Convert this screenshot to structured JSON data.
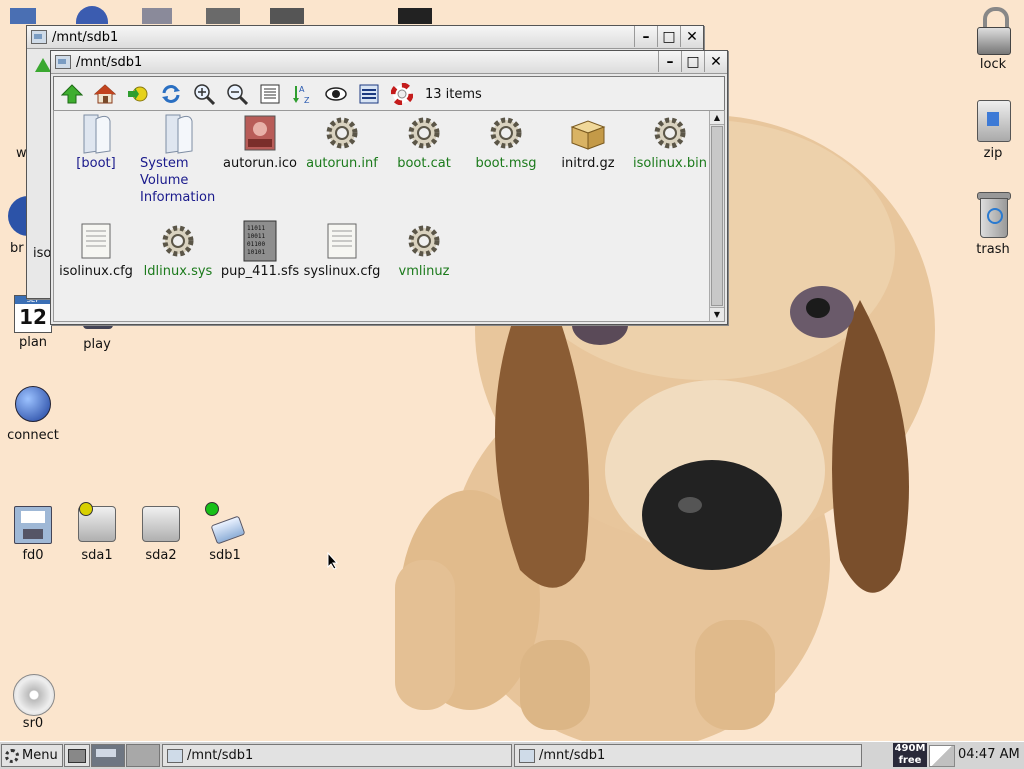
{
  "desktop": {
    "left_icons": [
      {
        "label": "plan",
        "date": "12",
        "month": "SEP"
      },
      {
        "label": "play"
      },
      {
        "label": "connect"
      },
      {
        "label": "fd0"
      },
      {
        "label": "sda1"
      },
      {
        "label": "sda2"
      },
      {
        "label": "sdb1"
      },
      {
        "label": "sr0"
      }
    ],
    "partial_labels": {
      "w": "w",
      "br": "br",
      "iso": "iso"
    },
    "right_icons": [
      {
        "label": "lock"
      },
      {
        "label": "zip"
      },
      {
        "label": "trash"
      }
    ]
  },
  "back_window": {
    "title": "/mnt/sdb1"
  },
  "front_window": {
    "title": "/mnt/sdb1",
    "item_count": "13 items",
    "toolbar_icons": [
      "up-arrow-icon",
      "home-icon",
      "goto-icon",
      "refresh-icon",
      "zoom-in-icon",
      "zoom-out-icon",
      "details-view-icon",
      "sort-az-icon",
      "eye-icon",
      "list-view-icon",
      "help-lifebuoy-icon"
    ],
    "files": [
      {
        "name": "[boot]",
        "kind": "dir",
        "icon": "folder-icon"
      },
      {
        "name": "System Volume Information",
        "kind": "dir",
        "icon": "folder-icon"
      },
      {
        "name": "autorun.ico",
        "kind": "reg",
        "icon": "image-icon"
      },
      {
        "name": "autorun.inf",
        "kind": "exe",
        "icon": "gear-icon"
      },
      {
        "name": "boot.cat",
        "kind": "exe",
        "icon": "gear-icon"
      },
      {
        "name": "boot.msg",
        "kind": "exe",
        "icon": "gear-icon"
      },
      {
        "name": "initrd.gz",
        "kind": "reg",
        "icon": "package-icon"
      },
      {
        "name": "isolinux.bin",
        "kind": "exe",
        "icon": "gear-icon"
      },
      {
        "name": "isolinux.cfg",
        "kind": "reg",
        "icon": "text-file-icon"
      },
      {
        "name": "ldlinux.sys",
        "kind": "exe",
        "icon": "gear-icon"
      },
      {
        "name": "pup_411.sfs",
        "kind": "reg",
        "icon": "binary-file-icon"
      },
      {
        "name": "syslinux.cfg",
        "kind": "reg",
        "icon": "text-file-icon"
      },
      {
        "name": "vmlinuz",
        "kind": "exe",
        "icon": "gear-icon"
      }
    ]
  },
  "taskbar": {
    "menu_label": "Menu",
    "task1": "/mnt/sdb1",
    "task2": "/mnt/sdb1",
    "mem_amount": "490M",
    "mem_label": "free",
    "clock": "04:47 AM"
  },
  "window_buttons": {
    "minimize": "–",
    "maximize": "□",
    "close": "✕"
  },
  "colors": {
    "desktop_bg": "#fbe5cd",
    "dir_text": "#1a1a8c",
    "exe_text": "#1b7a1b"
  }
}
